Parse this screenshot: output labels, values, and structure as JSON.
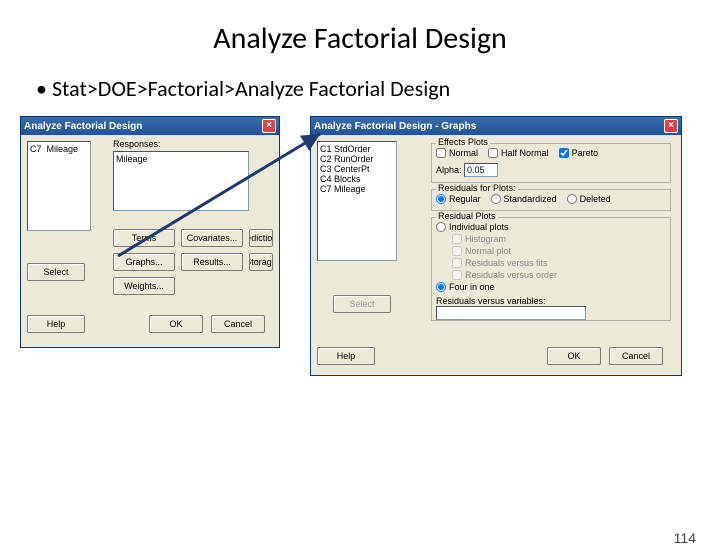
{
  "slide": {
    "title": "Analyze Factorial Design",
    "bullet": "Stat>DOE>Factorial>Analyze Factorial Design",
    "page": "114"
  },
  "dialog1": {
    "title": "Analyze Factorial Design",
    "close": "×",
    "col_list": {
      "col": "C7",
      "name": "Mileage"
    },
    "responses_label": "Responses:",
    "responses_value": "Mileage",
    "btn_select": "Select",
    "btn_help": "Help",
    "btn_terms": "Terms",
    "btn_covariates": "Covariates...",
    "btn_prediction": "Prediction...",
    "btn_graphs": "Graphs...",
    "btn_results": "Results...",
    "btn_storage": "Storage",
    "btn_weights": "Weights...",
    "btn_ok": "OK",
    "btn_cancel": "Cancel"
  },
  "dialog2": {
    "title": "Analyze Factorial Design - Graphs",
    "close": "×",
    "columns": [
      {
        "c": "C1",
        "n": "StdOrder"
      },
      {
        "c": "C2",
        "n": "RunOrder"
      },
      {
        "c": "C3",
        "n": "CenterPt"
      },
      {
        "c": "C4",
        "n": "Blocks"
      },
      {
        "c": "C7",
        "n": "Mileage"
      }
    ],
    "effects_title": "Effects Plots",
    "chk_normal": "Normal",
    "chk_halfnormal": "Half Normal",
    "chk_pareto": "Pareto",
    "alpha_label": "Alpha:",
    "alpha_value": "0.05",
    "resfor_title": "Residuals for Plots:",
    "rad_regular": "Regular",
    "rad_standardized": "Standardized",
    "rad_deleted": "Deleted",
    "resplots_title": "Residual Plots",
    "rad_individual": "Individual plots",
    "opt_hist": "Histogram",
    "opt_normplot": "Normal plot",
    "opt_resfits": "Residuals versus fits",
    "opt_resorder": "Residuals versus order",
    "rad_fourone": "Four in one",
    "resvars_label": "Residuals versus variables:",
    "btn_select": "Select",
    "btn_help": "Help",
    "btn_ok": "OK",
    "btn_cancel": "Cancel"
  }
}
